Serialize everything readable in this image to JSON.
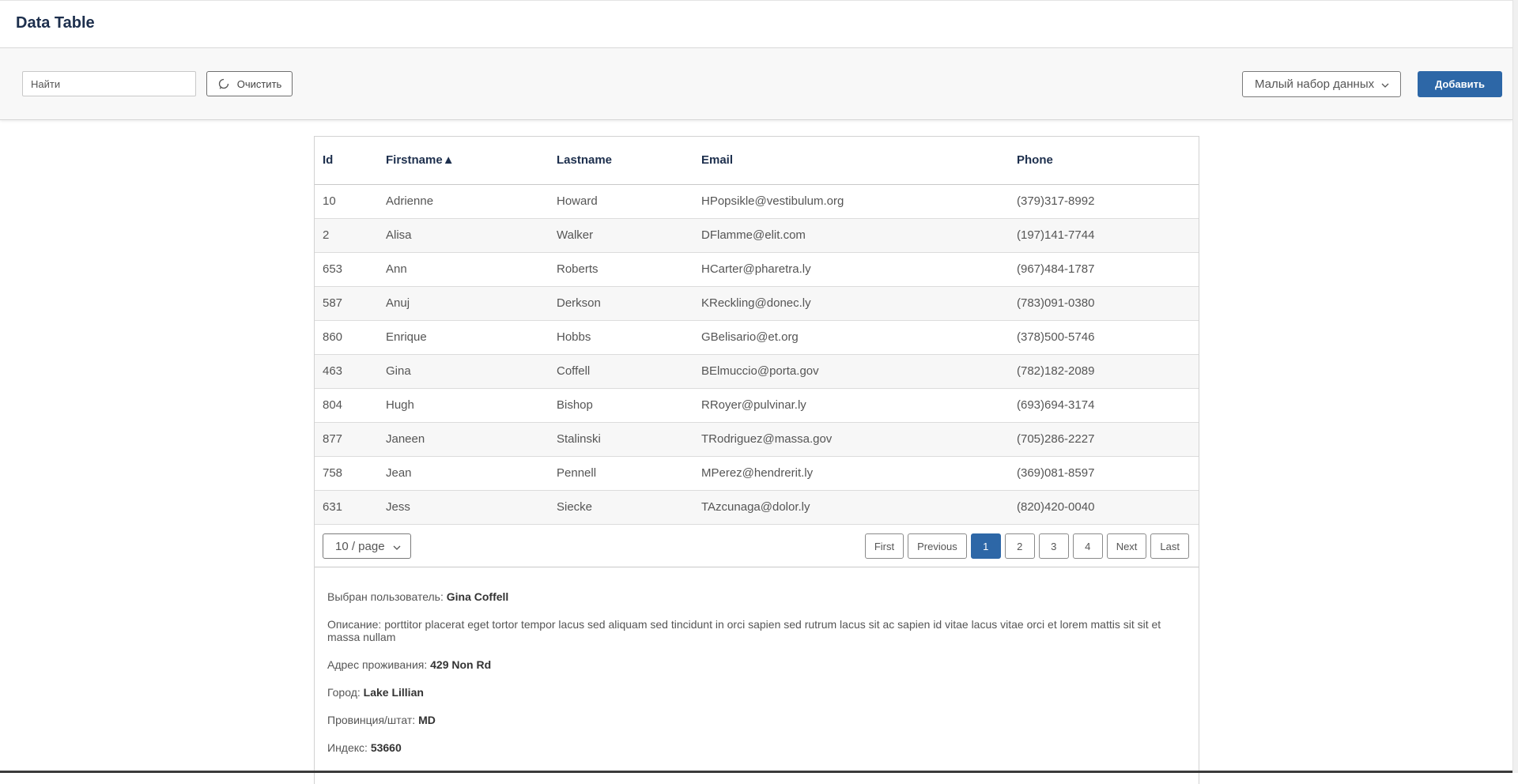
{
  "header": {
    "title": "Data Table"
  },
  "toolbar": {
    "search_placeholder": "Найти",
    "clear_label": "Очистить",
    "dataset_selected": "Малый набор данных",
    "add_label": "Добавить"
  },
  "table": {
    "columns": [
      "Id",
      "Firstname▲",
      "Lastname",
      "Email",
      "Phone"
    ],
    "rows": [
      [
        "10",
        "Adrienne",
        "Howard",
        "HPopsikle@vestibulum.org",
        "(379)317-8992"
      ],
      [
        "2",
        "Alisa",
        "Walker",
        "DFlamme@elit.com",
        "(197)141-7744"
      ],
      [
        "653",
        "Ann",
        "Roberts",
        "HCarter@pharetra.ly",
        "(967)484-1787"
      ],
      [
        "587",
        "Anuj",
        "Derkson",
        "KReckling@donec.ly",
        "(783)091-0380"
      ],
      [
        "860",
        "Enrique",
        "Hobbs",
        "GBelisario@et.org",
        "(378)500-5746"
      ],
      [
        "463",
        "Gina",
        "Coffell",
        "BElmuccio@porta.gov",
        "(782)182-2089"
      ],
      [
        "804",
        "Hugh",
        "Bishop",
        "RRoyer@pulvinar.ly",
        "(693)694-3174"
      ],
      [
        "877",
        "Janeen",
        "Stalinski",
        "TRodriguez@massa.gov",
        "(705)286-2227"
      ],
      [
        "758",
        "Jean",
        "Pennell",
        "MPerez@hendrerit.ly",
        "(369)081-8597"
      ],
      [
        "631",
        "Jess",
        "Siecke",
        "TAzcunaga@dolor.ly",
        "(820)420-0040"
      ]
    ]
  },
  "pager": {
    "page_size": "10 / page",
    "first": "First",
    "previous": "Previous",
    "pages": [
      "1",
      "2",
      "3",
      "4"
    ],
    "active_page": "1",
    "next": "Next",
    "last": "Last"
  },
  "details": {
    "selected_label": "Выбран пользователь:",
    "selected_value": "Gina Coffell",
    "description_label": "Описание:",
    "description_value": "porttitor placerat eget tortor tempor lacus sed aliquam sed tincidunt in orci sapien sed rutrum lacus sit ac sapien id vitae lacus vitae orci et lorem mattis sit sit et massa nullam",
    "address_label": "Адрес проживания:",
    "address_value": "429 Non Rd",
    "city_label": "Город:",
    "city_value": "Lake Lillian",
    "state_label": "Провинция/штат:",
    "state_value": "MD",
    "zip_label": "Индекс:",
    "zip_value": "53660"
  },
  "colors": {
    "accent": "#2d67a7",
    "heading": "#1d2f4d",
    "text": "#555555"
  },
  "icons": {
    "clear": "refresh-icon",
    "dropdown": "chevron-down-icon"
  }
}
